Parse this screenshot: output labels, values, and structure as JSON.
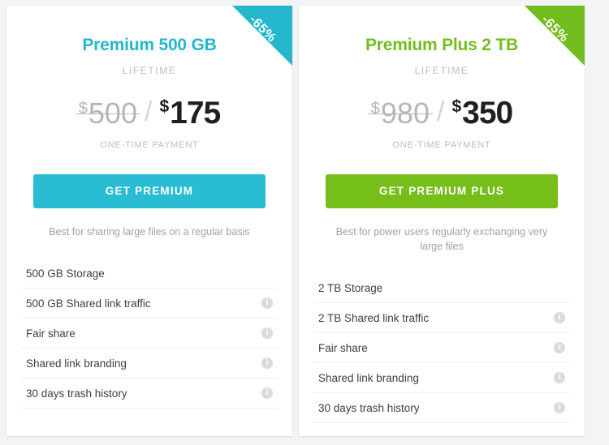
{
  "page": {
    "background_color": "#f2f4f5"
  },
  "plans": [
    {
      "id": "premium",
      "title": "Premium 500 GB",
      "period": "LIFETIME",
      "accent_color": "#25b7cc",
      "ribbon": {
        "label": "-65%",
        "color": "#25b7cc"
      },
      "price": {
        "currency": "$",
        "old": "500",
        "separator": "/",
        "new": "175",
        "note": "ONE-TIME PAYMENT"
      },
      "cta_label": "GET PREMIUM",
      "tagline": "Best for sharing large files on a regular basis",
      "features": [
        {
          "label": "500 GB Storage",
          "info": false,
          "info_icon": "info-icon"
        },
        {
          "label": "500 GB Shared link traffic",
          "info": true,
          "info_icon": "info-icon"
        },
        {
          "label": "Fair share",
          "info": true,
          "info_icon": "info-icon"
        },
        {
          "label": "Shared link branding",
          "info": true,
          "info_icon": "info-icon"
        },
        {
          "label": "30 days trash history",
          "info": true,
          "info_icon": "info-icon"
        }
      ]
    },
    {
      "id": "premium-plus",
      "title": "Premium Plus 2 TB",
      "period": "LIFETIME",
      "accent_color": "#73bd1f",
      "ribbon": {
        "label": "-65%",
        "color": "#73bd1f"
      },
      "price": {
        "currency": "$",
        "old": "980",
        "separator": "/",
        "new": "350",
        "note": "ONE-TIME PAYMENT"
      },
      "cta_label": "GET PREMIUM PLUS",
      "tagline": "Best for power users regularly exchanging very large files",
      "features": [
        {
          "label": "2 TB Storage",
          "info": false,
          "info_icon": "info-icon"
        },
        {
          "label": "2 TB Shared link traffic",
          "info": true,
          "info_icon": "info-icon"
        },
        {
          "label": "Fair share",
          "info": true,
          "info_icon": "info-icon"
        },
        {
          "label": "Shared link branding",
          "info": true,
          "info_icon": "info-icon"
        },
        {
          "label": "30 days trash history",
          "info": true,
          "info_icon": "info-icon"
        }
      ]
    }
  ],
  "info_glyph": "i"
}
